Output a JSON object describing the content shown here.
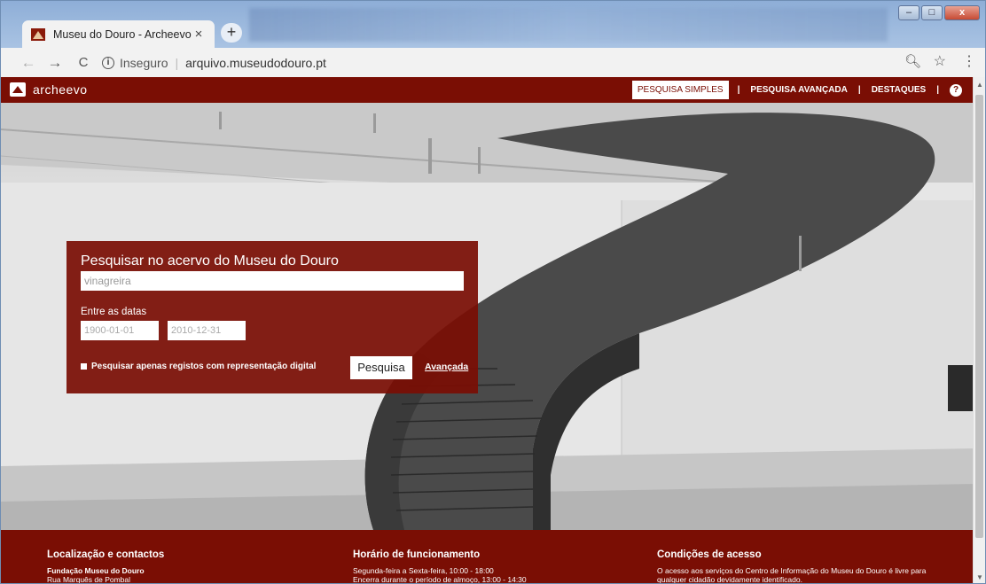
{
  "browser": {
    "tab_title": "Museu do Douro - Archeevo",
    "tab_close": "×",
    "new_tab": "+",
    "security_label": "Inseguro",
    "separator": "|",
    "url": "arquivo.museudodouro.pt",
    "icons": [
      "back-arrow-icon",
      "forward-arrow-icon",
      "reload-icon",
      "info-icon",
      "zoom-icon",
      "star-icon",
      "menu-icon"
    ],
    "window_controls": {
      "minimize": "–",
      "maximize": "□",
      "close": "x"
    }
  },
  "site": {
    "brand": "archeevo",
    "brand_color": "#7a0e04",
    "nav": {
      "simple": "PESQUISA SIMPLES",
      "advanced": "PESQUISA AVANÇADA",
      "highlights": "DESTAQUES",
      "separator": "|",
      "help": "?"
    }
  },
  "search": {
    "heading": "Pesquisar no acervo do Museu do Douro",
    "query_value": "vinagreira",
    "dates_label": "Entre as datas",
    "date_from": "1900-01-01",
    "date_to": "2010-12-31",
    "digital_only_label": "Pesquisar apenas registos com representação digital",
    "digital_only_checked": false,
    "search_button": "Pesquisa",
    "advanced_link": "Avançada"
  },
  "footer": {
    "contacts": {
      "title": "Localização e contactos",
      "line1": "Fundação Museu do Douro",
      "line2": "Rua Marquês de Pombal"
    },
    "hours": {
      "title": "Horário de funcionamento",
      "line1": "Segunda-feira a Sexta-feira, 10:00 - 18:00",
      "line2": "Encerra durante o período de almoço, 13:00 - 14:30"
    },
    "access": {
      "title": "Condições de acesso",
      "line1": "O acesso aos serviços do Centro de Informação do Museu do Douro é livre para",
      "line2": "qualquer cidadão devidamente identificado."
    }
  }
}
